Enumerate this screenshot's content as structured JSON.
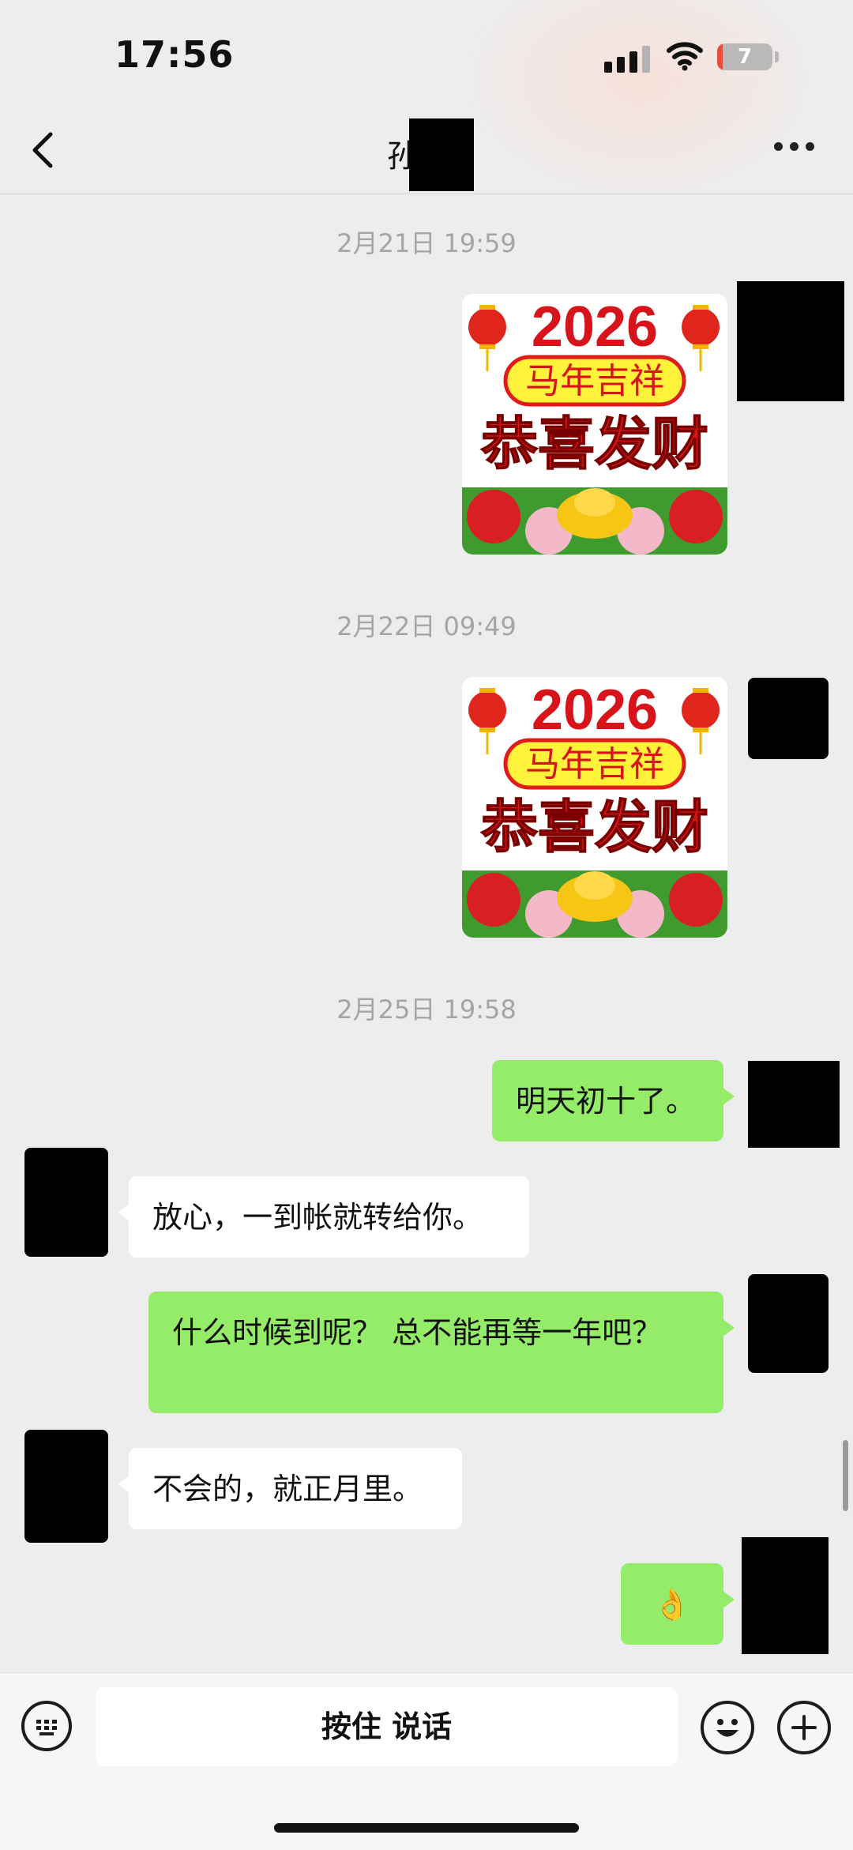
{
  "status_bar": {
    "time": "17:56",
    "battery": "7"
  },
  "header": {
    "contact_name": "孙"
  },
  "messages": [
    {
      "type": "timestamp",
      "text": "2月21日 19:59"
    },
    {
      "type": "sticker",
      "direction": "out",
      "sticker": {
        "year": "2026",
        "banner": "马年吉祥",
        "greeting": "恭喜发财"
      }
    },
    {
      "type": "timestamp",
      "text": "2月22日 09:49"
    },
    {
      "type": "sticker",
      "direction": "out",
      "sticker": {
        "year": "2026",
        "banner": "马年吉祥",
        "greeting": "恭喜发财"
      }
    },
    {
      "type": "timestamp",
      "text": "2月25日 19:58"
    },
    {
      "type": "text",
      "direction": "out",
      "text": "明天初十了。"
    },
    {
      "type": "text",
      "direction": "in",
      "text": "放心，一到帐就转给你。"
    },
    {
      "type": "text",
      "direction": "out",
      "text": "什么时候到呢？ 总不能再等一年吧？"
    },
    {
      "type": "text",
      "direction": "in",
      "text": "不会的，就正月里。"
    },
    {
      "type": "emoji",
      "direction": "out",
      "text": "👌"
    }
  ],
  "input_bar": {
    "hold_to_talk": "按住 说话",
    "voice_icon": "keyboard-icon",
    "emoji_icon": "emoji-icon",
    "plus_icon": "plus-icon"
  }
}
